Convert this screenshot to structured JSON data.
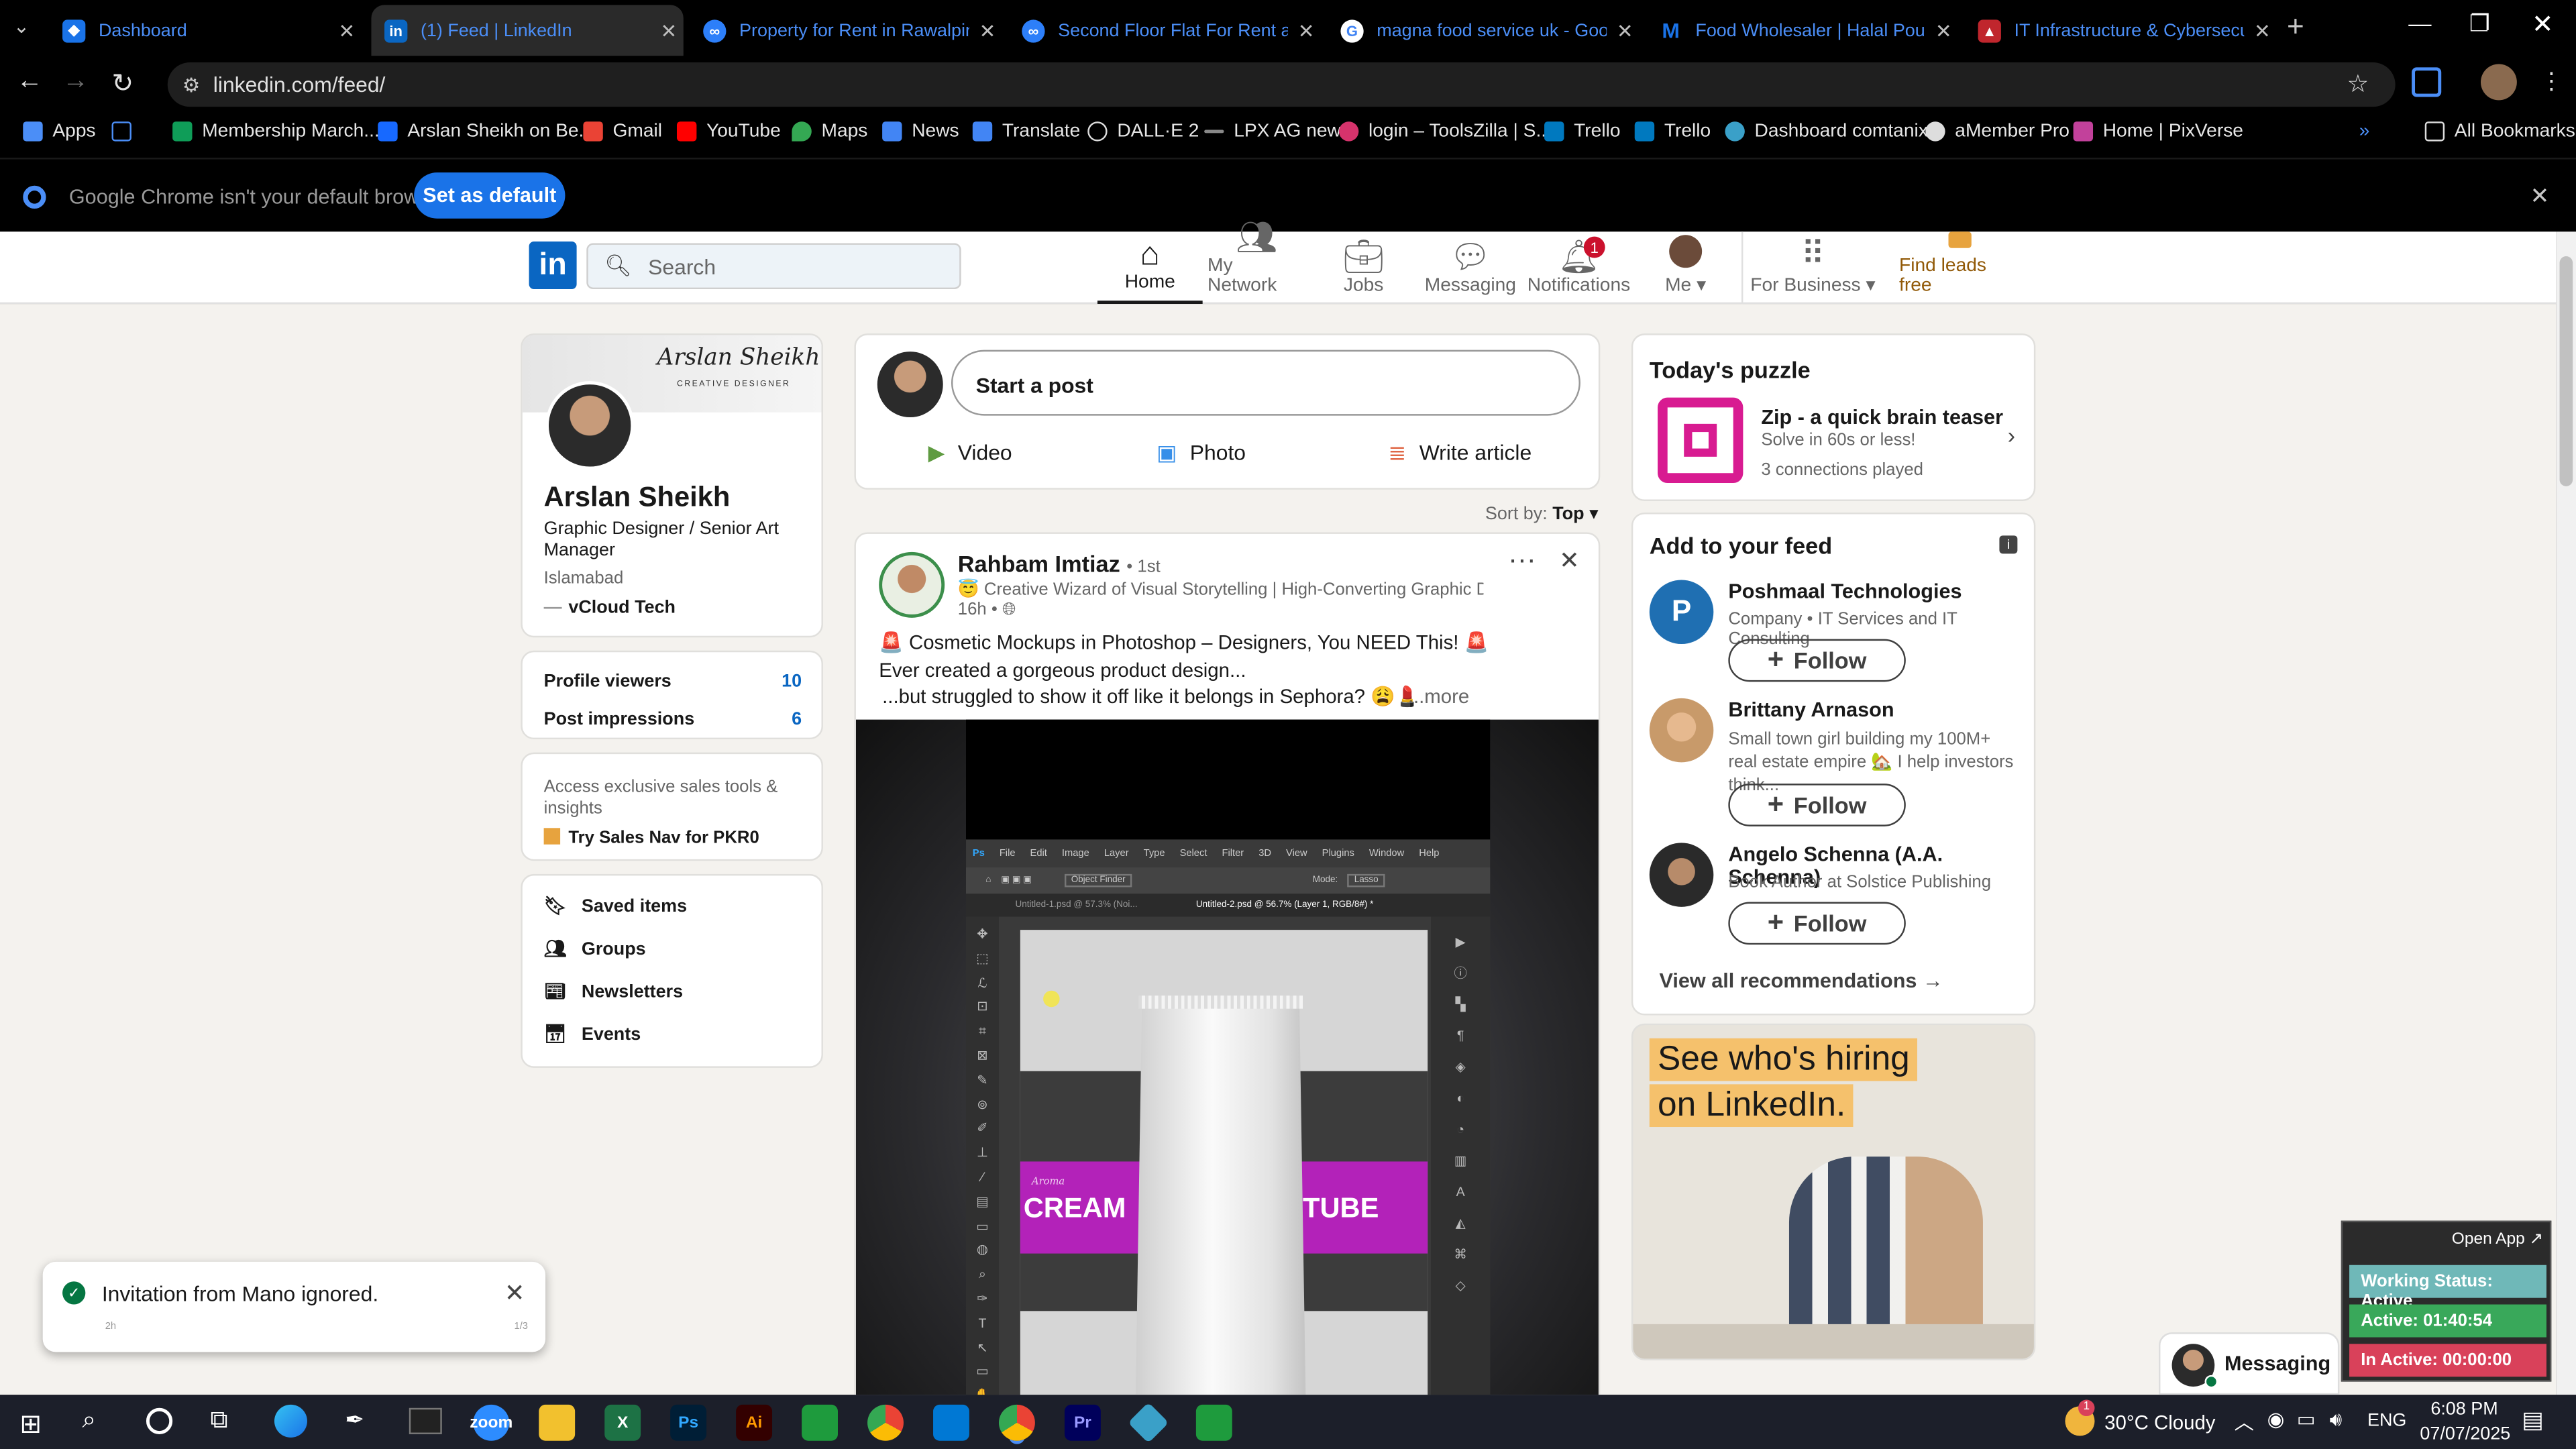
{
  "browser": {
    "tabs": [
      {
        "title": "Dashboard",
        "icon": "chrome-app-icon",
        "color": "#4b8ef7"
      },
      {
        "title": "(1) Feed | LinkedIn",
        "icon": "linkedin-icon",
        "color": "#0a66c2"
      },
      {
        "title": "Property for Rent in Rawalpindi",
        "icon": "zameen-icon",
        "color": "#1a73e8"
      },
      {
        "title": "Second Floor Flat For Rent at A",
        "icon": "zameen-icon",
        "color": "#1a73e8"
      },
      {
        "title": "magna food service uk - Google",
        "icon": "google-icon",
        "color": "#ffffff"
      },
      {
        "title": "Food Wholesaler | Halal Poultry",
        "icon": "m-logo-icon",
        "color": "#1a73e8"
      },
      {
        "title": "IT Infrastructure & Cybersecurity",
        "icon": "shield-logo-icon",
        "color": "#c0262d"
      }
    ],
    "url": "linkedin.com/feed/",
    "bookmarks": [
      {
        "label": "Apps",
        "icon": "apps-grid-icon"
      },
      {
        "label": "Membership March...",
        "icon": "sheets-icon"
      },
      {
        "label": "Arslan Sheikh on Be...",
        "icon": "behance-icon"
      },
      {
        "label": "Gmail",
        "icon": "gmail-icon"
      },
      {
        "label": "YouTube",
        "icon": "youtube-icon"
      },
      {
        "label": "Maps",
        "icon": "maps-icon"
      },
      {
        "label": "News",
        "icon": "news-icon"
      },
      {
        "label": "Translate",
        "icon": "translate-icon"
      },
      {
        "label": "DALL·E 2",
        "icon": "openai-icon"
      },
      {
        "label": "LPX AG new",
        "icon": "dash-icon"
      },
      {
        "label": "login – ToolsZilla | S...",
        "icon": "toolszilla-icon"
      },
      {
        "label": "Trello",
        "icon": "trello-icon"
      },
      {
        "label": "Trello",
        "icon": "trello-icon"
      },
      {
        "label": "Dashboard comtanix",
        "icon": "dashboard-icon"
      },
      {
        "label": "aMember Pro",
        "icon": "amember-icon"
      },
      {
        "label": "Home | PixVerse",
        "icon": "pixverse-icon"
      }
    ],
    "all_bookmarks": "All Bookmarks",
    "infobar": {
      "message": "Google Chrome isn't your default browser",
      "button": "Set as default"
    }
  },
  "linkedin": {
    "search_placeholder": "Search",
    "nav": [
      {
        "label": "Home",
        "icon": "home-icon"
      },
      {
        "label": "My Network",
        "icon": "network-icon"
      },
      {
        "label": "Jobs",
        "icon": "briefcase-icon"
      },
      {
        "label": "Messaging",
        "icon": "chat-icon"
      },
      {
        "label": "Notifications",
        "icon": "bell-icon",
        "badge": "1"
      },
      {
        "label": "Me",
        "icon": "avatar-icon"
      },
      {
        "label": "For Business",
        "icon": "grid-icon"
      },
      {
        "label": "Find leads free",
        "icon": "sales-nav-icon"
      }
    ],
    "profile": {
      "banner_name": "Arslan Sheikh",
      "banner_sub": "CREATIVE DESIGNER",
      "name": "Arslan Sheikh",
      "headline": "Graphic Designer / Senior Art Manager",
      "location": "Islamabad",
      "company": "vCloud Tech",
      "stats": [
        {
          "label": "Profile viewers",
          "value": "10"
        },
        {
          "label": "Post impressions",
          "value": "6"
        }
      ],
      "premium_text": "Access exclusive sales tools & insights",
      "premium_cta": "Try Sales Nav for PKR0",
      "links": [
        {
          "label": "Saved items",
          "icon": "bookmark-icon"
        },
        {
          "label": "Groups",
          "icon": "groups-icon"
        },
        {
          "label": "Newsletters",
          "icon": "newsletter-icon"
        },
        {
          "label": "Events",
          "icon": "calendar-icon"
        }
      ]
    },
    "composer": {
      "placeholder": "Start a post",
      "actions": [
        {
          "label": "Video",
          "color": "#5f9b41"
        },
        {
          "label": "Photo",
          "color": "#378fe9"
        },
        {
          "label": "Write article",
          "color": "#e06847"
        }
      ]
    },
    "sort": {
      "label": "Sort by:",
      "value": "Top"
    },
    "post": {
      "author": "Rahbam Imtiaz",
      "degree": "• 1st",
      "subtitle": "😇 Creative Wizard of Visual Storytelling | High-Converting Graphic Des...",
      "time": "16h •",
      "line1": "🚨 Cosmetic Mockups in Photoshop – Designers, You NEED This! 🚨",
      "line2": "Ever created a gorgeous product design...",
      "line3": "...but struggled to show it off like it belongs in Sephora? 😩💄",
      "more": "...more",
      "image": {
        "menu": [
          "File",
          "Edit",
          "Image",
          "Layer",
          "Type",
          "Select",
          "Filter",
          "3D",
          "View",
          "Plugins",
          "Window",
          "Help"
        ],
        "doc_tab1": "Untitled-1.psd @ 57.3% (Noi...",
        "doc_tab2": "Untitled-2.psd @ 56.7% (Layer 1, RGB/8#) *",
        "option_label": "Object Finder",
        "mode_label": "Mode:",
        "mode_value": "Lasso",
        "script_label": "Aroma",
        "label_left": "CREAM",
        "label_right": "TUBE"
      }
    },
    "puzzle": {
      "heading": "Today's puzzle",
      "title": "Zip - a quick brain teaser",
      "sub": "Solve in 60s or less!",
      "meta": "3 connections played"
    },
    "feed_suggestions": {
      "heading": "Add to your feed",
      "items": [
        {
          "name": "Poshmaal Technologies",
          "desc": "Company • IT Services and IT Consulting",
          "button": "Follow"
        },
        {
          "name": "Brittany Arnason",
          "desc": "Small town girl building my 100M+ real estate empire 🏡 I help investors think...",
          "button": "Follow"
        },
        {
          "name": "Angelo Schenna (A.A. Schenna)",
          "desc": "Book Author at Solstice Publishing",
          "button": "Follow"
        }
      ],
      "view_all": "View all recommendations →"
    },
    "ad": {
      "line1": "See who's hiring",
      "line2": "on LinkedIn."
    },
    "messaging_label": "Messaging"
  },
  "toast": {
    "message": "Invitation from Mano ignored.",
    "time": "2h",
    "count": "1/3"
  },
  "tracker": {
    "open_app": "Open App ↗",
    "working": "Working Status: Active",
    "active": "Active: 01:40:54",
    "inactive": "In Active: 00:00:00"
  },
  "taskbar": {
    "weather": "30°C  Cloudy",
    "weather_badge": "1",
    "lang": "ENG",
    "time": "6:08 PM",
    "date": "07/07/2025",
    "apps": [
      {
        "name": "zoom-icon",
        "color": "#2d8cff",
        "label": "zoom"
      },
      {
        "name": "file-explorer-icon",
        "color": "#f2c12e",
        "label": ""
      },
      {
        "name": "excel-icon",
        "color": "#1d7245",
        "label": "X"
      },
      {
        "name": "photoshop-icon",
        "color": "#001e36",
        "label": "Ps"
      },
      {
        "name": "illustrator-icon",
        "color": "#330000",
        "label": "Ai"
      },
      {
        "name": "green-app-icon",
        "color": "#1e9b3d",
        "label": ""
      },
      {
        "name": "chrome-icon",
        "color": "#dd4b39",
        "label": ""
      },
      {
        "name": "vscode-icon",
        "color": "#0078d4",
        "label": ""
      },
      {
        "name": "chrome-active-icon",
        "color": "#dd4b39",
        "label": ""
      },
      {
        "name": "premiere-icon",
        "color": "#00005b",
        "label": "Pr"
      },
      {
        "name": "diamond-app-icon",
        "color": "#3aa0c8",
        "label": ""
      },
      {
        "name": "green-app-2-icon",
        "color": "#1e9b3d",
        "label": ""
      }
    ]
  }
}
